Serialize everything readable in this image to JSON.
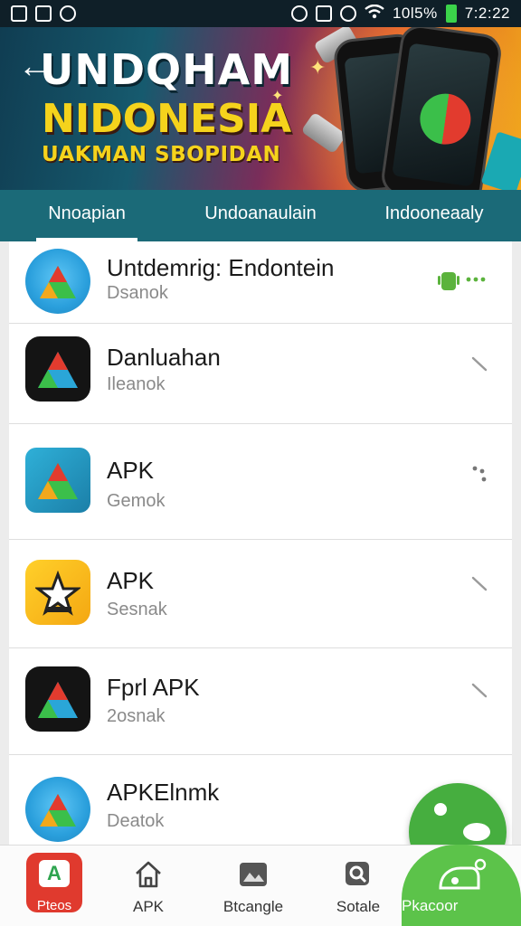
{
  "status_bar": {
    "battery": "10l5%",
    "time": "7:2:22"
  },
  "banner": {
    "title_line1": "UNDQHAM",
    "title_line2": "NIDONESIA",
    "subtitle": "UAKMAN SBOPIDAN",
    "back_icon": "back-arrow-icon"
  },
  "tabs": [
    {
      "label": "Nnoapian",
      "active": true
    },
    {
      "label": "Undoanaulain",
      "active": false
    },
    {
      "label": "Indooneaaly",
      "active": false
    }
  ],
  "apps": [
    {
      "title": "Untdemrig: Endontein",
      "subtitle": "Dsanok",
      "icon": "app-blue-circle-icon",
      "action": "android-icon"
    },
    {
      "title": "Danluahan",
      "subtitle": "Ileanok",
      "icon": "app-dark-triangle-icon",
      "action": "more-icon"
    },
    {
      "title": "APK",
      "subtitle": "Gemok",
      "icon": "app-teal-triangle-icon",
      "action": "dots-icon"
    },
    {
      "title": "APK",
      "subtitle": "Sesnak",
      "icon": "app-yellow-star-icon",
      "action": "more-icon"
    },
    {
      "title": "Fprl APK",
      "subtitle": "2osnak",
      "icon": "app-dark-triangle-icon",
      "action": "more-icon"
    },
    {
      "title": "APKElnmk",
      "subtitle": "Deatok",
      "icon": "app-blue-circle-icon",
      "action": ""
    }
  ],
  "bottom_nav": [
    {
      "label": "Pteos",
      "icon": "apps-icon"
    },
    {
      "label": "APK",
      "icon": "home-icon"
    },
    {
      "label": "Btcangle",
      "icon": "image-icon"
    },
    {
      "label": "Sotale",
      "icon": "search-icon"
    },
    {
      "label": "Pkacoor",
      "icon": "featured-icon"
    }
  ],
  "colors": {
    "tab_bar": "#1b6a78",
    "fab": "#46ae3f",
    "featured": "#5cc34a",
    "apps_icon": "#e03a2e"
  }
}
